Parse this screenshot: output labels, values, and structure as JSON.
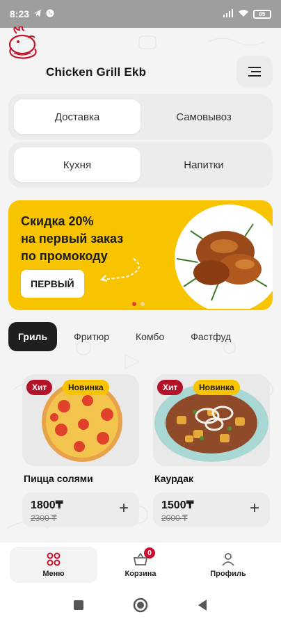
{
  "status": {
    "time": "8:23",
    "battery": "85"
  },
  "app": {
    "brand": "Chicken Grill Ekb"
  },
  "delivery_mode": {
    "options": [
      "Доставка",
      "Самовывоз"
    ],
    "selected": "Доставка"
  },
  "section": {
    "options": [
      "Кухня",
      "Напитки"
    ],
    "selected": "Кухня"
  },
  "banner": {
    "line1": "Скидка 20%",
    "line2": "на первый заказ",
    "line3": "по промокоду",
    "promo_code": "ПЕРВЫЙ"
  },
  "categories": [
    {
      "label": "Гриль",
      "active": true
    },
    {
      "label": "Фритюр",
      "active": false
    },
    {
      "label": "Комбо",
      "active": false
    },
    {
      "label": "Фастфуд",
      "active": false
    }
  ],
  "products": [
    {
      "name": "Пицца солями",
      "price": "1800₸",
      "old_price": "2300 ₸",
      "tags": [
        "Хит",
        "Новинка"
      ]
    },
    {
      "name": "Каурдак",
      "price": "1500₸",
      "old_price": "2000 ₸",
      "tags": [
        "Хит",
        "Новинка"
      ]
    }
  ],
  "bottom_nav": [
    {
      "label": "Меню",
      "icon": "grid-icon",
      "active": true
    },
    {
      "label": "Корзина",
      "icon": "basket-icon",
      "badge": "0"
    },
    {
      "label": "Профиль",
      "icon": "user-icon"
    }
  ],
  "colors": {
    "accent_yellow": "#f8c400",
    "hit_red": "#b3132a",
    "active_dark": "#1f1f1f"
  }
}
